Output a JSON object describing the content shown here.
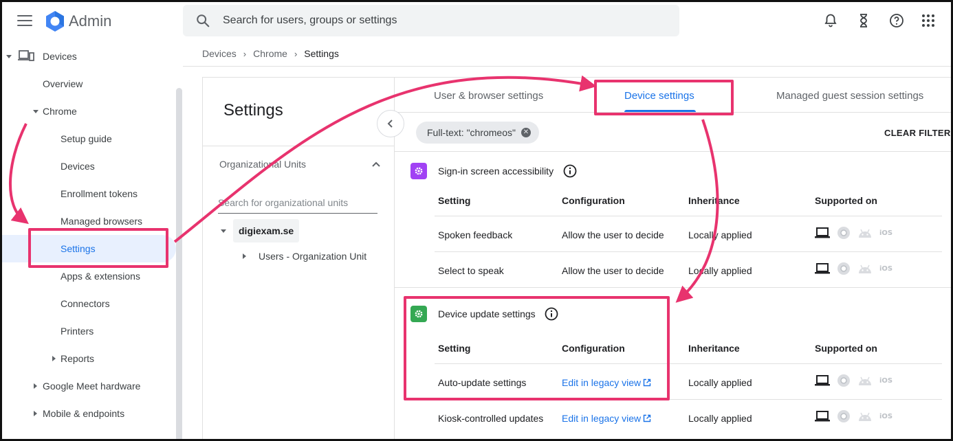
{
  "app": {
    "title": "Admin"
  },
  "search": {
    "placeholder": "Search for users, groups or settings"
  },
  "sidebar": {
    "devices": "Devices",
    "overview": "Overview",
    "chrome": "Chrome",
    "items": [
      "Setup guide",
      "Devices",
      "Enrollment tokens",
      "Managed browsers",
      "Settings",
      "Apps & extensions",
      "Connectors",
      "Printers"
    ],
    "reports": "Reports",
    "meet": "Google Meet hardware",
    "mobile": "Mobile & endpoints"
  },
  "breadcrumb": [
    "Devices",
    "Chrome",
    "Settings"
  ],
  "org_panel": {
    "title": "Settings",
    "heading": "Organizational Units",
    "search_placeholder": "Search for organizational units",
    "root": "digiexam.se",
    "child": "Users - Organization Unit"
  },
  "tabs": [
    "User & browser settings",
    "Device settings",
    "Managed guest session settings"
  ],
  "filter": {
    "chip": "Full-text: \"chromeos\"",
    "clear": "CLEAR FILTERS"
  },
  "columns": {
    "setting": "Setting",
    "configuration": "Configuration",
    "inheritance": "Inheritance",
    "supported": "Supported on"
  },
  "sections": [
    {
      "title": "Sign-in screen accessibility",
      "icon": "gear-icon",
      "color": "#a142f4",
      "rows": [
        {
          "setting": "Spoken feedback",
          "configuration": "Allow the user to decide",
          "inheritance": "Locally applied"
        },
        {
          "setting": "Select to speak",
          "configuration": "Allow the user to decide",
          "inheritance": "Locally applied"
        }
      ]
    },
    {
      "title": "Device update settings",
      "icon": "gear-icon",
      "color": "#34a853",
      "rows": [
        {
          "setting": "Auto-update settings",
          "configuration": "Edit in legacy view",
          "inheritance": "Locally applied"
        },
        {
          "setting": "Kiosk-controlled updates",
          "configuration": "Edit in legacy view",
          "inheritance": "Locally applied"
        }
      ]
    }
  ],
  "platforms": {
    "ios": "iOS"
  },
  "colors": {
    "accent": "#1a73e8",
    "annotation": "#e8336e"
  }
}
